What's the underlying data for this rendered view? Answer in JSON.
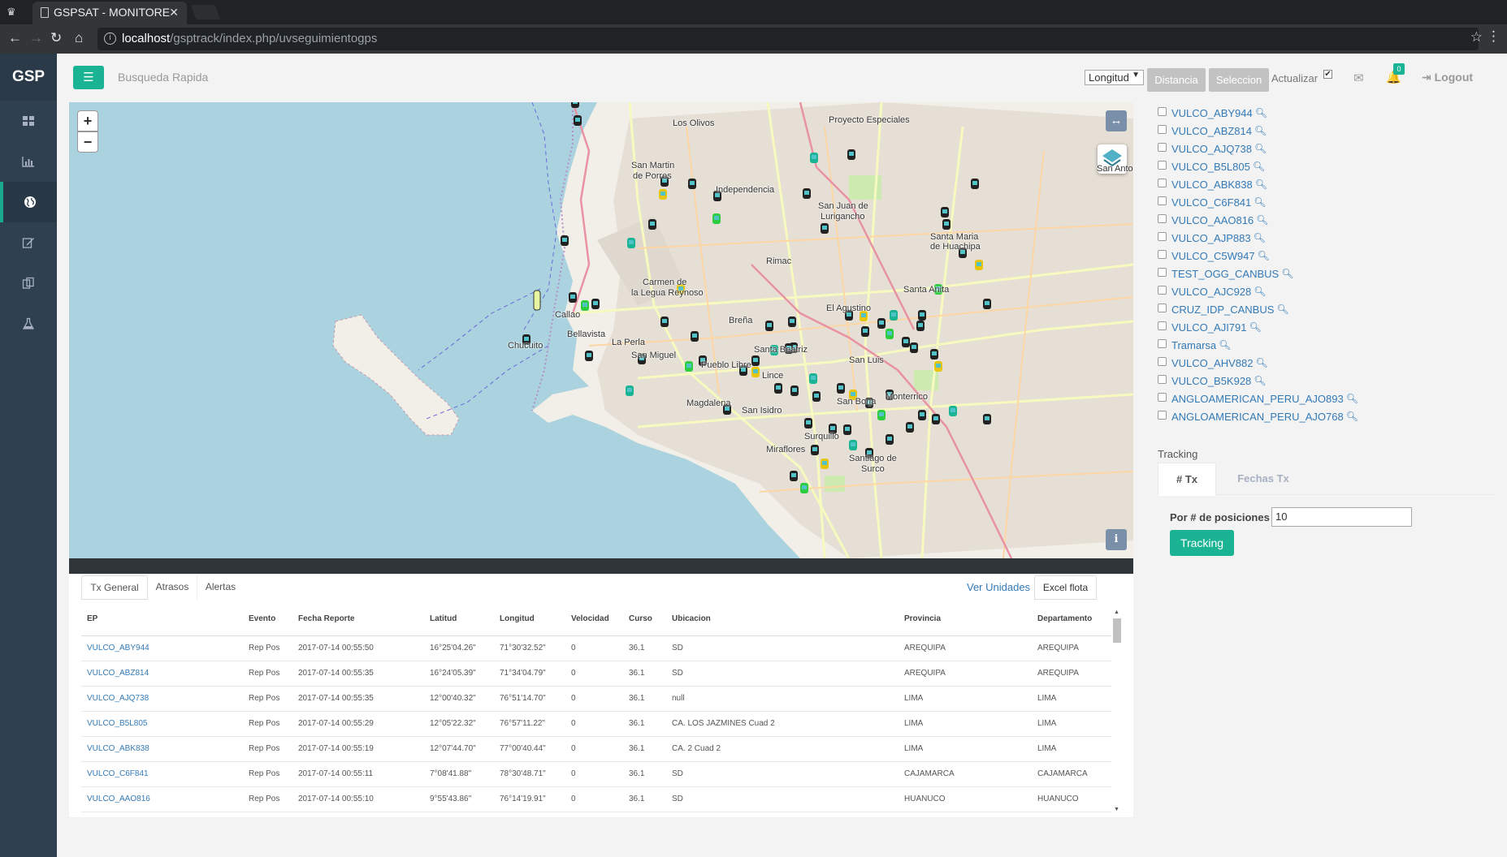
{
  "browser": {
    "tab_title": "GSPSAT - MONITORE",
    "url_host": "localhost",
    "url_path": "/gsptrack/index.php/uvseguimientogps"
  },
  "sidebar": {
    "logo": "GSP",
    "items": [
      {
        "icon": "dashboard-grid-icon",
        "active": false
      },
      {
        "icon": "bar-chart-icon",
        "active": false
      },
      {
        "icon": "globe-icon",
        "active": true
      },
      {
        "icon": "edit-icon",
        "active": false
      },
      {
        "icon": "copy-icon",
        "active": false
      },
      {
        "icon": "flask-icon",
        "active": false
      }
    ]
  },
  "navbar": {
    "quick_search": "Busqueda Rapida",
    "measure_select": "Longitud",
    "btn_distancia": "Distancia",
    "btn_seleccion": "Seleccion",
    "refresh_label": "Actualizar",
    "refresh_checked": true,
    "notification_count": "0",
    "logout": "Logout"
  },
  "map": {
    "places": [
      "Los Olivos",
      "Proyecto Especiales",
      "San Martin",
      "de Porres",
      "Independencia",
      "San Juan de",
      "Lurigancho",
      "Santa Maria",
      "de Huachipa",
      "Rimac",
      "Carmen de",
      "la Legua Reynoso",
      "Callao",
      "Bellavista",
      "El Agustino",
      "Santa Anita",
      "Chucuito",
      "La Perla",
      "Breña",
      "San Miguel",
      "Santa Beatriz",
      "Pueblo Libre",
      "Lince",
      "San Luis",
      "Monterrico",
      "Magdalena",
      "San Isidro",
      "San Borja",
      "Surquillo",
      "Miraflores",
      "Santiago de",
      "Surco",
      "San Anto"
    ]
  },
  "units": [
    "VULCO_ABY944",
    "VULCO_ABZ814",
    "VULCO_AJQ738",
    "VULCO_B5L805",
    "VULCO_ABK838",
    "VULCO_C6F841",
    "VULCO_AAO816",
    "VULCO_AJP883",
    "VULCO_C5W947",
    "TEST_OGG_CANBUS",
    "VULCO_AJC928",
    "CRUZ_IDP_CANBUS",
    "VULCO_AJI791",
    "Tramarsa",
    "VULCO_AHV882",
    "VULCO_B5K928",
    "ANGLOAMERICAN_PERU_AJO893",
    "ANGLOAMERICAN_PERU_AJO768"
  ],
  "tracking": {
    "title": "Tracking",
    "tab_tx": "# Tx",
    "tab_fechas": "Fechas Tx",
    "positions_label": "Por # de posiciones",
    "positions_value": "10",
    "button": "Tracking"
  },
  "bottom": {
    "tabs": {
      "general": "Tx General",
      "atrasos": "Atrasos",
      "alertas": "Alertas"
    },
    "ver_unidades": "Ver Unidades",
    "excel": "Excel flota",
    "columns": [
      "EP",
      "Evento",
      "Fecha Reporte",
      "Latitud",
      "Longitud",
      "Velocidad",
      "Curso",
      "Ubicacion",
      "Provincia",
      "Departamento"
    ],
    "rows": [
      [
        "VULCO_ABY944",
        "Rep Pos",
        "2017-07-14 00:55:50",
        "16°25'04.26\"",
        "71°30'32.52\"",
        "0",
        "36.1",
        "SD",
        "AREQUIPA",
        "AREQUIPA"
      ],
      [
        "VULCO_ABZ814",
        "Rep Pos",
        "2017-07-14 00:55:35",
        "16°24'05.39\"",
        "71°34'04.79\"",
        "0",
        "36.1",
        "SD",
        "AREQUIPA",
        "AREQUIPA"
      ],
      [
        "VULCO_AJQ738",
        "Rep Pos",
        "2017-07-14 00:55:35",
        "12°00'40.32\"",
        "76°51'14.70\"",
        "0",
        "36.1",
        "null",
        "LIMA",
        "LIMA"
      ],
      [
        "VULCO_B5L805",
        "Rep Pos",
        "2017-07-14 00:55:29",
        "12°05'22.32\"",
        "76°57'11.22\"",
        "0",
        "36.1",
        "CA. LOS JAZMINES Cuad 2",
        "LIMA",
        "LIMA"
      ],
      [
        "VULCO_ABK838",
        "Rep Pos",
        "2017-07-14 00:55:19",
        "12°07'44.70\"",
        "77°00'40.44\"",
        "0",
        "36.1",
        "CA. 2 Cuad 2",
        "LIMA",
        "LIMA"
      ],
      [
        "VULCO_C6F841",
        "Rep Pos",
        "2017-07-14 00:55:11",
        "7°08'41.88\"",
        "78°30'48.71\"",
        "0",
        "36.1",
        "SD",
        "CAJAMARCA",
        "CAJAMARCA"
      ],
      [
        "VULCO_AAO816",
        "Rep Pos",
        "2017-07-14 00:55:10",
        "9°55'43.86\"",
        "76°14'19.91\"",
        "0",
        "36.1",
        "SD",
        "HUANUCO",
        "HUANUCO"
      ]
    ]
  }
}
